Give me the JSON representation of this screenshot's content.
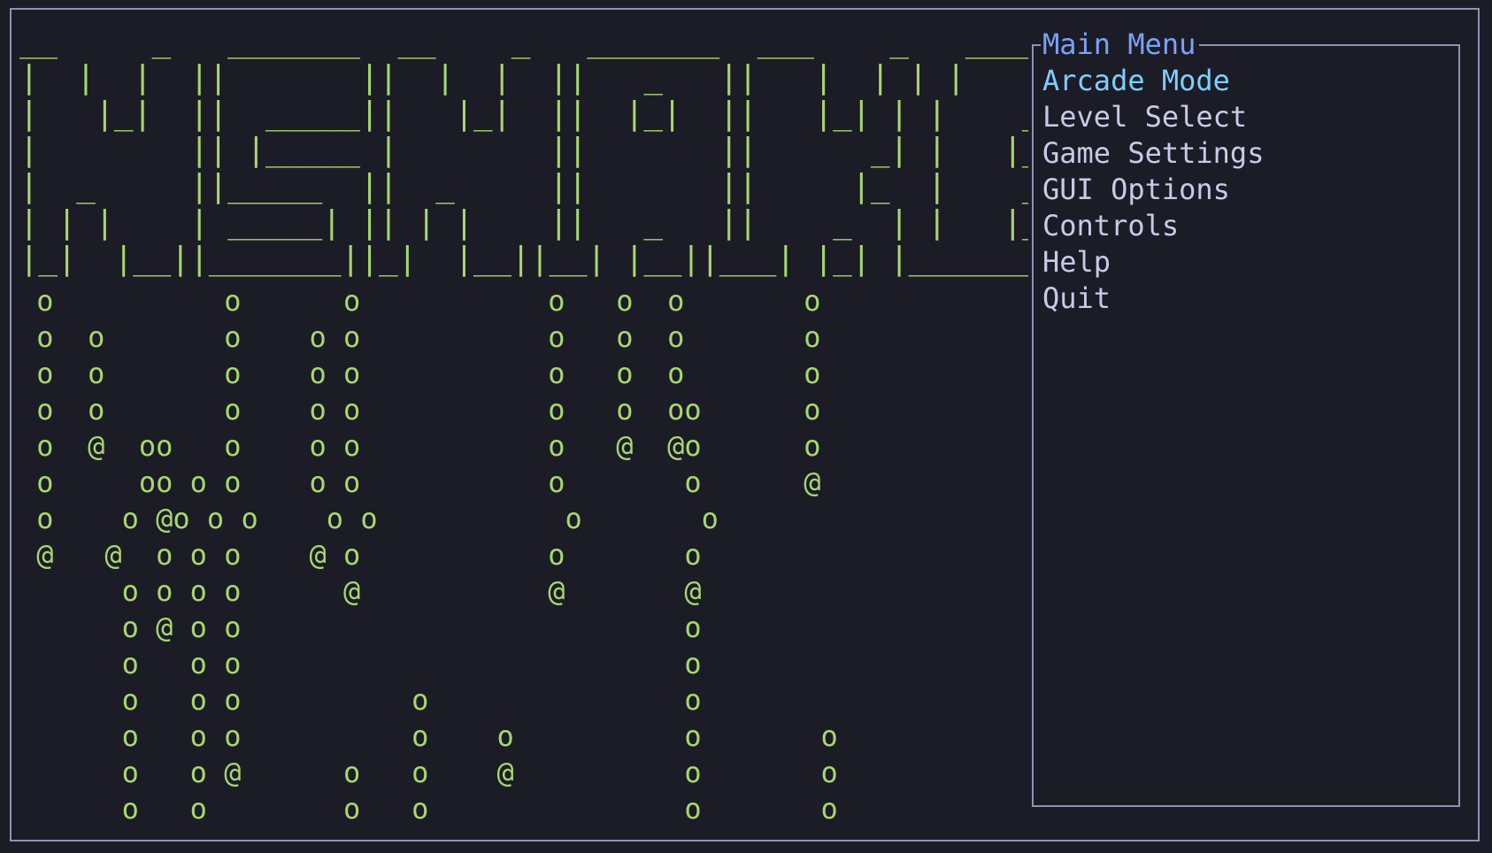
{
  "colors": {
    "background": "#1c1c27",
    "frame": "#8e92b5",
    "accent_green": "#a6d86d",
    "menu_title": "#7aa2f7",
    "menu_active": "#7dcfff",
    "menu_text": "#c6cbe7"
  },
  "logo": {
    "lines": [
      "__     _   _______  __    _   _______  ___    _   _______",
      "|  |  |  ||       ||  |  |  ||   _   ||   |  | | |       |",
      "|   |_|  ||  _____||   |_|  ||  |_|  ||   |_| | |    ___|",
      "|        || |_____ |        ||       ||      _| |   |___ ",
      "|  _     ||_____  ||  _     ||       ||     |_  |    ___|",
      "| | |    | _____| || | |    ||   _   ||    _  | |   |___ ",
      "|_|  |__||_______||_|  |__||__| |__||___| |_| |_______|"
    ]
  },
  "rain": {
    "lines": [
      " o          o      o           o   o  o       o",
      " o  o       o    o o           o   o  o       o",
      " o  o       o    o o           o   o  o       o",
      " o  o       o    o o           o   o  oo      o",
      " o  @  oo   o    o o           o   @  @o      o",
      " o     oo o o    o o           o       o      @",
      " o    o @o o o    o o           o       o",
      " @   @  o o o    @ o           o       o",
      "      o o o o      @           @       @",
      "      o @ o o                          o",
      "      o   o o                          o",
      "      o   o o          o               o",
      "      o   o o          o    o          o       o",
      "      o   o @      o   o    @          o       o",
      "      o   o        o   o               o       o"
    ]
  },
  "menu": {
    "title": "Main Menu",
    "items": [
      {
        "label": "Arcade Mode",
        "active": true
      },
      {
        "label": "Level Select",
        "active": false
      },
      {
        "label": "Game Settings",
        "active": false
      },
      {
        "label": "GUI Options",
        "active": false
      },
      {
        "label": "Controls",
        "active": false
      },
      {
        "label": "Help",
        "active": false
      },
      {
        "label": "Quit",
        "active": false
      }
    ]
  }
}
